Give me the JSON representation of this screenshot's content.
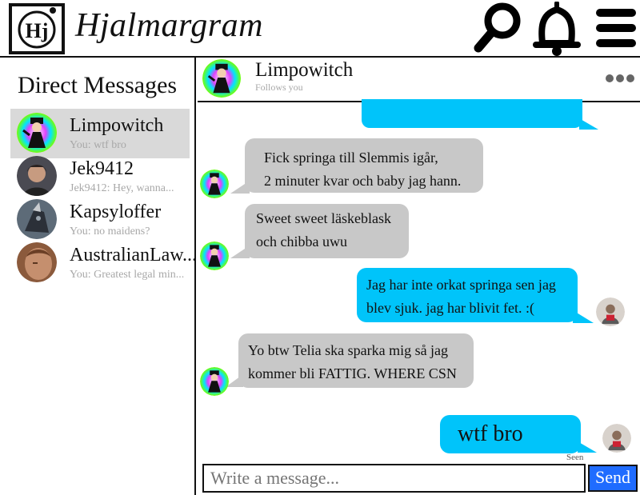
{
  "app": {
    "brand": "Hjalmargram",
    "logo_text": "Hj"
  },
  "header": {
    "icons": [
      "search-icon",
      "bell-icon",
      "menu-icon"
    ]
  },
  "sidebar": {
    "title": "Direct Messages",
    "conversations": [
      {
        "name": "Limpowitch",
        "preview": "You: wtf bro",
        "active": true
      },
      {
        "name": "Jek9412",
        "preview": "Jek9412: Hey, wanna...",
        "active": false
      },
      {
        "name": "Kapsyloffer",
        "preview": "You: no maidens?",
        "active": false
      },
      {
        "name": "AustralianLaw...",
        "preview": "You: Greatest legal min...",
        "active": false
      }
    ]
  },
  "chat": {
    "name": "Limpowitch",
    "subtitle": "Follows you",
    "messages": [
      {
        "from": "them",
        "lines": [
          "Fick springa till Slemmis igår,",
          "2 minuter kvar och baby jag hann."
        ]
      },
      {
        "from": "them",
        "lines": [
          "Sweet sweet läskeblask",
          "och chibba uwu"
        ]
      },
      {
        "from": "me",
        "lines": [
          "Jag har inte orkat springa sen jag",
          "blev sjuk. jag har blivit fet. :("
        ]
      },
      {
        "from": "them",
        "lines": [
          "Yo btw Telia ska sparka mig så jag",
          "kommer bli FATTIG. WHERE CSN"
        ]
      },
      {
        "from": "me",
        "lines": [
          "wtf bro"
        ]
      }
    ],
    "seen_label": "Seen"
  },
  "composer": {
    "placeholder": "Write a message...",
    "send_label": "Send"
  },
  "colors": {
    "outgoing_bubble": "#00c4fa",
    "incoming_bubble": "#c8c8c8",
    "send_button": "#1f6cff",
    "active_conversation": "#d9d9d9"
  }
}
